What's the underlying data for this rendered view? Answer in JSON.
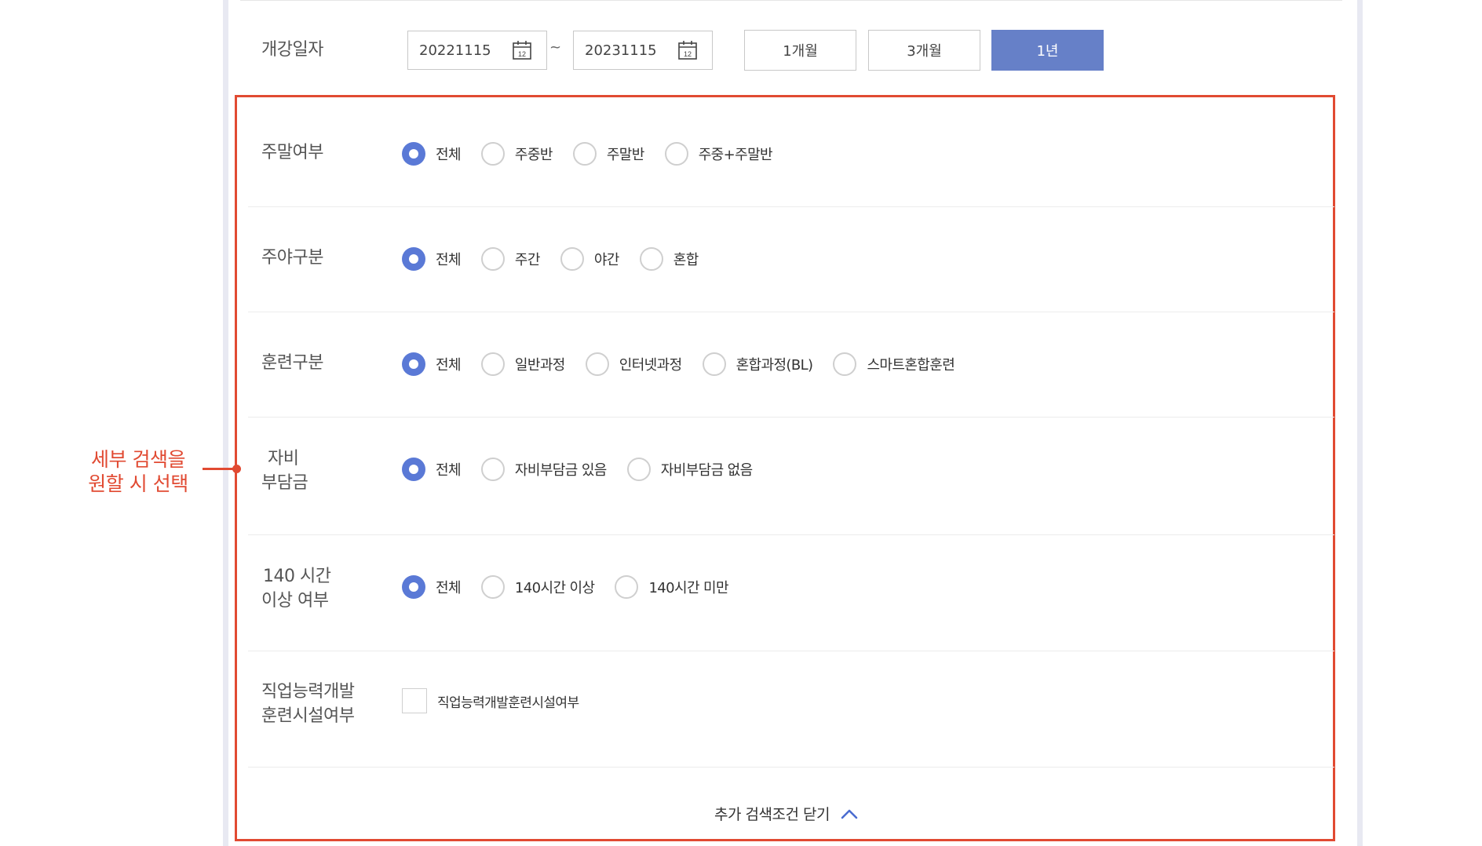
{
  "date_row": {
    "label": "개강일자",
    "start_date": "20221115",
    "end_date": "20231115",
    "separator": "~",
    "calendar_day": "12",
    "period_buttons": [
      "1개월",
      "3개월",
      "1년"
    ],
    "active_period": "1년"
  },
  "filters": [
    {
      "label_lines": [
        "주말여부"
      ],
      "type": "radio",
      "options": [
        "전체",
        "주중반",
        "주말반",
        "주중+주말반"
      ],
      "selected": "전체"
    },
    {
      "label_lines": [
        "주야구분"
      ],
      "type": "radio",
      "options": [
        "전체",
        "주간",
        "야간",
        "혼합"
      ],
      "selected": "전체"
    },
    {
      "label_lines": [
        "훈련구분"
      ],
      "type": "radio",
      "options": [
        "전체",
        "일반과정",
        "인터넷과정",
        "혼합과정(BL)",
        "스마트혼합훈련"
      ],
      "selected": "전체"
    },
    {
      "label_lines": [
        "자비",
        "부담금"
      ],
      "type": "radio",
      "options": [
        "전체",
        "자비부담금 있음",
        "자비부담금 없음"
      ],
      "selected": "전체"
    },
    {
      "label_lines": [
        "140 시간",
        "이상 여부"
      ],
      "type": "radio",
      "options": [
        "전체",
        "140시간 이상",
        "140시간 미만"
      ],
      "selected": "전체"
    },
    {
      "label_lines": [
        "직업능력개발",
        "훈련시설여부"
      ],
      "type": "checkbox",
      "checkbox_label": "직업능력개발훈련시설여부",
      "checked": false
    }
  ],
  "close_link": {
    "label": "추가 검색조건 닫기",
    "icon": "chevron-up-icon"
  },
  "annotation": {
    "lines": [
      "세부 검색을",
      "원할 시 선택"
    ],
    "color": "#e14a32"
  },
  "colors": {
    "accent": "#5a79d6",
    "active_button": "#6680c8",
    "highlight": "#e14a32"
  }
}
